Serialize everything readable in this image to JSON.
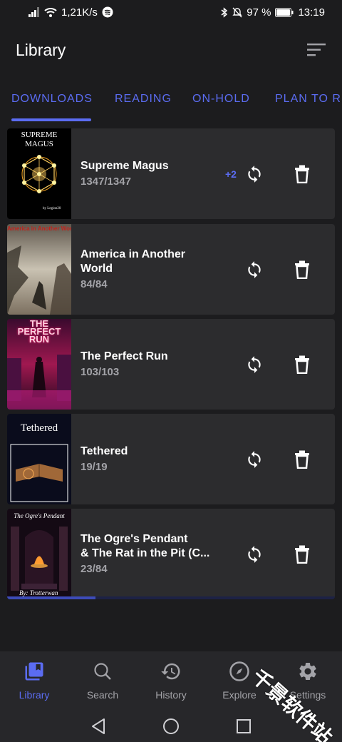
{
  "status_bar": {
    "signal": "signal-bars-icon",
    "speed": "1,21K/s",
    "battery": "97 %",
    "time": "13:19"
  },
  "app_bar": {
    "title": "Library"
  },
  "tabs": [
    {
      "label": "DOWNLOADS",
      "active": true
    },
    {
      "label": "READING",
      "active": false
    },
    {
      "label": "ON-HOLD",
      "active": false
    },
    {
      "label": "PLAN TO READ",
      "active": false
    }
  ],
  "downloads": [
    {
      "title": "Supreme Magus",
      "count": "1347/1347",
      "badge": "+2",
      "cover": {
        "title": "SUPREME\nMAGUS",
        "author": "by Legion20"
      }
    },
    {
      "title": "America in Another\nWorld",
      "count": "84/84",
      "cover": {
        "title": "America in Another World"
      }
    },
    {
      "title": "The Perfect Run",
      "count": "103/103",
      "cover": {
        "title": "THE\nPERFECT\nRUN"
      }
    },
    {
      "title": "Tethered",
      "count": "19/19",
      "cover": {
        "title": "Tethered"
      }
    },
    {
      "title": "The Ogre's Pendant\n& The Rat in the Pit (C...",
      "count": "23/84",
      "progress": 0.27,
      "cover": {
        "title": "The Ogre's Pendant",
        "author": "By: Trotterwan"
      }
    }
  ],
  "bottom_nav": [
    {
      "label": "Library",
      "icon": "library-icon",
      "active": true
    },
    {
      "label": "Search",
      "icon": "search-icon",
      "active": false
    },
    {
      "label": "History",
      "icon": "history-icon",
      "active": false
    },
    {
      "label": "Explore",
      "icon": "explore-icon",
      "active": false
    },
    {
      "label": "Settings",
      "icon": "settings-icon",
      "active": false
    }
  ],
  "watermark": "千景软件站",
  "colors": {
    "accent": "#5b6cf2",
    "background": "#1c1c1e",
    "card": "#2c2c2e",
    "nav": "#27272a"
  }
}
